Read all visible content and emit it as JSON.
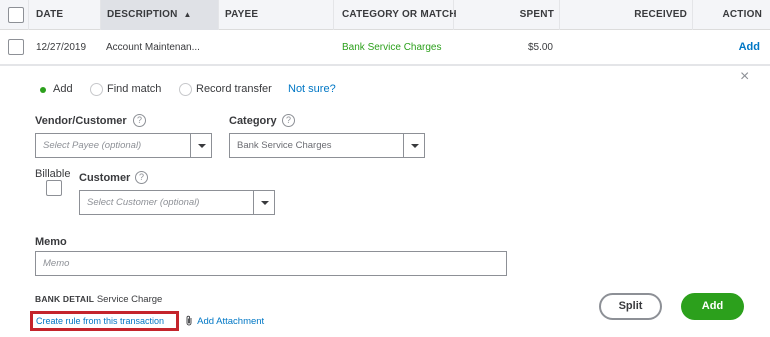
{
  "table": {
    "columns": {
      "date": "DATE",
      "description": "DESCRIPTION",
      "payee": "PAYEE",
      "category": "CATEGORY OR MATCH",
      "spent": "SPENT",
      "received": "RECEIVED",
      "action": "ACTION"
    },
    "sort_indicator": "▲",
    "row": {
      "date": "12/27/2019",
      "description": "Account Maintenan...",
      "payee": "",
      "category": "Bank Service Charges",
      "spent": "$5.00",
      "received": "",
      "action": "Add"
    }
  },
  "panel": {
    "close_glyph": "×",
    "mode_options": [
      {
        "label": "Add",
        "selected": true
      },
      {
        "label": "Find match",
        "selected": false
      },
      {
        "label": "Record transfer",
        "selected": false
      }
    ],
    "not_sure": "Not sure?",
    "vendor": {
      "label": "Vendor/Customer",
      "placeholder": "Select Payee (optional)"
    },
    "category": {
      "label": "Category",
      "value": "Bank Service Charges"
    },
    "billable_label": "Billable",
    "customer": {
      "label": "Customer",
      "placeholder": "Select Customer (optional)"
    },
    "memo": {
      "label": "Memo",
      "placeholder": "Memo"
    },
    "bank_detail": {
      "label": "BANK DETAIL",
      "value": "Service Charge"
    },
    "create_rule": "Create rule from this transaction",
    "add_attachment": "Add Attachment",
    "split_button": "Split",
    "add_button": "Add",
    "help_glyph": "?"
  },
  "colors": {
    "accent_green": "#2ca01c",
    "link_blue": "#0077c5",
    "highlight_red": "#c4242b",
    "category_green": "#2ca01c"
  }
}
